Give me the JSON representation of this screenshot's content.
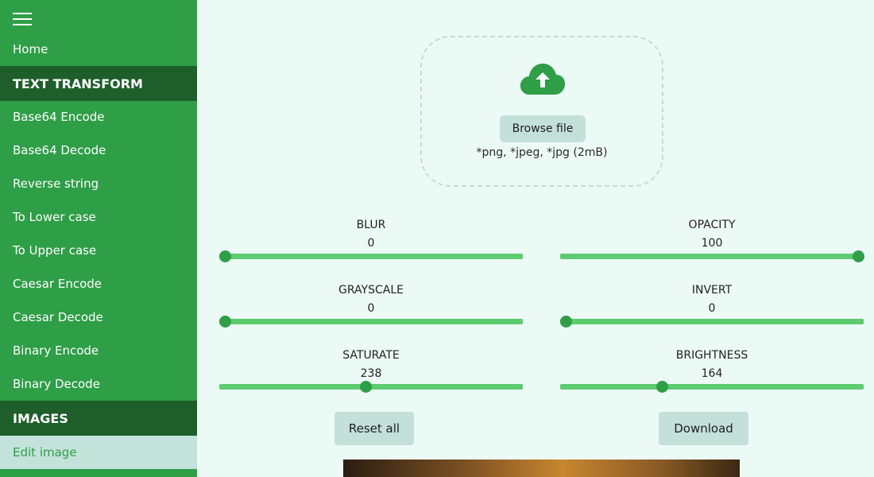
{
  "sidebar": {
    "menu_icon": "hamburger-menu-icon",
    "home": "Home",
    "section_text": "TEXT TRANSFORM",
    "text_items": [
      "Base64 Encode",
      "Base64 Decode",
      "Reverse string",
      "To Lower case",
      "To Upper case",
      "Caesar Encode",
      "Caesar Decode",
      "Binary Encode",
      "Binary Decode"
    ],
    "section_images": "IMAGES",
    "images_items": [
      "Edit image"
    ],
    "active_item": "Edit image"
  },
  "upload": {
    "icon": "cloud-upload-icon",
    "browse_label": "Browse file",
    "hint": "*png, *jpeg, *jpg (2mB)"
  },
  "filters": {
    "blur": {
      "label": "BLUR",
      "value": "0",
      "fraction": 0.0
    },
    "opacity": {
      "label": "OPACITY",
      "value": "100",
      "fraction": 1.0
    },
    "grayscale": {
      "label": "GRAYSCALE",
      "value": "0",
      "fraction": 0.0
    },
    "invert": {
      "label": "INVERT",
      "value": "0",
      "fraction": 0.0
    },
    "saturate": {
      "label": "SATURATE",
      "value": "238",
      "fraction": 0.48
    },
    "brightness": {
      "label": "BRIGHTNESS",
      "value": "164",
      "fraction": 0.33
    }
  },
  "actions": {
    "reset_label": "Reset all",
    "download_label": "Download"
  },
  "colors": {
    "sidebar": "#2e9e47",
    "section": "#1e5e2a",
    "active_bg": "#c3e3da",
    "track": "#5dcb6f",
    "thumb": "#2e9e47",
    "page_bg": "#ecfaf5"
  }
}
